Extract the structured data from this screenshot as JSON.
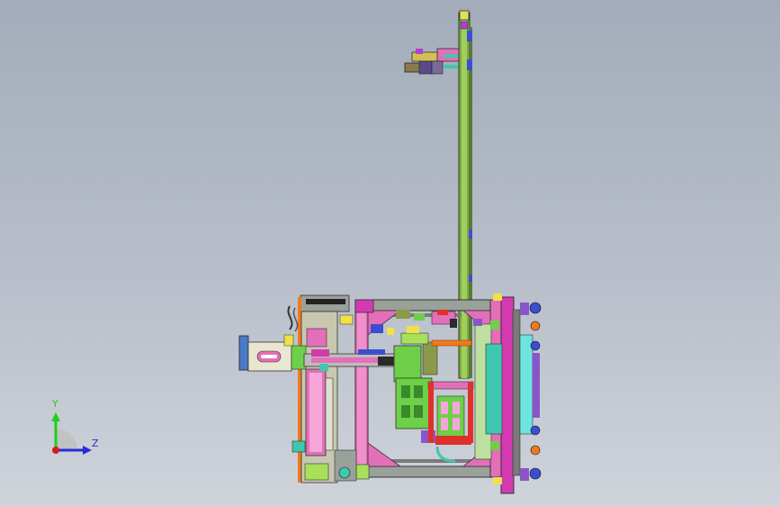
{
  "viewport": {
    "background_top": "#a3acba",
    "background_bottom": "#cfd3da"
  },
  "triad": {
    "y_label": "Y",
    "z_label": "Z",
    "y_color": "#1bd11b",
    "z_color": "#2b2bd6",
    "x_color": "#d81b1b"
  },
  "palette": {
    "frame_gray": "#9aa09a",
    "pink": "#e46fb9",
    "magenta": "#d43ab0",
    "green": "#6ecf4a",
    "lime": "#a8e05a",
    "olive": "#8a9a4a",
    "orange": "#f07a1a",
    "red": "#e0302a",
    "teal": "#3fc7b0",
    "cyan": "#6fe3e0",
    "purple": "#8a55c8",
    "yellow": "#f0e04a",
    "dark": "#2a2a2a",
    "blue": "#3a4fd0"
  }
}
